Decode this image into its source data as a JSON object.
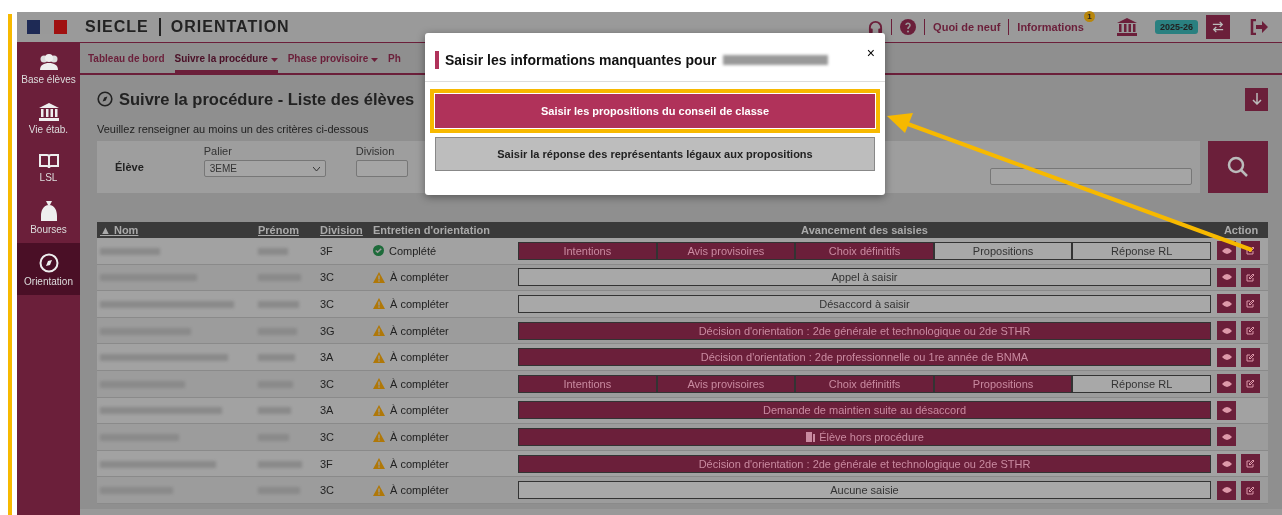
{
  "header": {
    "brand": "SIECLE",
    "app": "ORIENTATION",
    "links": [
      "Quoi de neuf",
      "Informations"
    ],
    "info_badge": "1",
    "year": "2025-26"
  },
  "sidebar": {
    "items": [
      {
        "label": "Base élèves",
        "selected": false
      },
      {
        "label": "Vie étab.",
        "selected": false
      },
      {
        "label": "LSL",
        "selected": false
      },
      {
        "label": "Bourses",
        "selected": false
      },
      {
        "label": "Orientation",
        "selected": true
      }
    ]
  },
  "nav": {
    "tabs": [
      {
        "label": "Tableau de bord",
        "dropdown": false,
        "selected": false
      },
      {
        "label": "Suivre la procédure",
        "dropdown": true,
        "selected": true
      },
      {
        "label": "Phase provisoire",
        "dropdown": true,
        "selected": false
      },
      {
        "label": "Ph",
        "dropdown": false,
        "selected": false
      }
    ]
  },
  "page": {
    "title": "Suivre la procédure - Liste des élèves",
    "hint": "Veuillez renseigner au moins un des critères ci-dessous"
  },
  "filters": {
    "label": "Élève",
    "palier_label": "Palier",
    "palier_value": "3EME",
    "division_label": "Division"
  },
  "table": {
    "sort_mark": "▲",
    "columns": [
      "Nom",
      "Prénom",
      "Division",
      "Entretien d'orientation",
      "Avancement des saisies",
      "Action"
    ],
    "rows": [
      {
        "division": "3F",
        "status": "Complété",
        "complete": true,
        "kind": "steps",
        "steps": [
          {
            "label": "Intentions",
            "done": true
          },
          {
            "label": "Avis provisoires",
            "done": true
          },
          {
            "label": "Choix définitifs",
            "done": true
          },
          {
            "label": "Propositions",
            "done": false
          },
          {
            "label": "Réponse RL",
            "done": false
          }
        ],
        "edit": true
      },
      {
        "division": "3C",
        "status": "À compléter",
        "complete": false,
        "kind": "single",
        "progress": "Appel à saisir",
        "done": false,
        "edit": true
      },
      {
        "division": "3C",
        "status": "À compléter",
        "complete": false,
        "kind": "single",
        "progress": "Désaccord à saisir",
        "done": false,
        "edit": true
      },
      {
        "division": "3G",
        "status": "À compléter",
        "complete": false,
        "kind": "single",
        "progress": "Décision d'orientation : 2de générale et technologique ou 2de STHR",
        "done": true,
        "edit": true
      },
      {
        "division": "3A",
        "status": "À compléter",
        "complete": false,
        "kind": "single",
        "progress": "Décision d'orientation : 2de professionnelle ou 1re année de BNMA",
        "done": true,
        "edit": true
      },
      {
        "division": "3C",
        "status": "À compléter",
        "complete": false,
        "kind": "steps",
        "steps": [
          {
            "label": "Intentions",
            "done": true
          },
          {
            "label": "Avis provisoires",
            "done": true
          },
          {
            "label": "Choix définitifs",
            "done": true
          },
          {
            "label": "Propositions",
            "done": true
          },
          {
            "label": "Réponse RL",
            "done": false
          }
        ],
        "edit": true
      },
      {
        "division": "3A",
        "status": "À compléter",
        "complete": false,
        "kind": "single",
        "progress": "Demande de maintien suite au désaccord",
        "done": true,
        "edit": false
      },
      {
        "division": "3C",
        "status": "À compléter",
        "complete": false,
        "kind": "out",
        "progress": "Élève hors procédure",
        "done": true,
        "edit": false
      },
      {
        "division": "3F",
        "status": "À compléter",
        "complete": false,
        "kind": "single",
        "progress": "Décision d'orientation : 2de générale et technologique ou 2de STHR",
        "done": true,
        "edit": true
      },
      {
        "division": "3C",
        "status": "À compléter",
        "complete": false,
        "kind": "single",
        "progress": "Aucune saisie",
        "done": false,
        "edit": true
      }
    ]
  },
  "modal": {
    "close": "×",
    "title": "Saisir les informations manquantes pour",
    "buttons": [
      {
        "label": "Saisir les propositions du conseil de classe",
        "primary": true
      },
      {
        "label": "Saisir la réponse des représentants légaux aux propositions",
        "primary": false
      }
    ]
  }
}
